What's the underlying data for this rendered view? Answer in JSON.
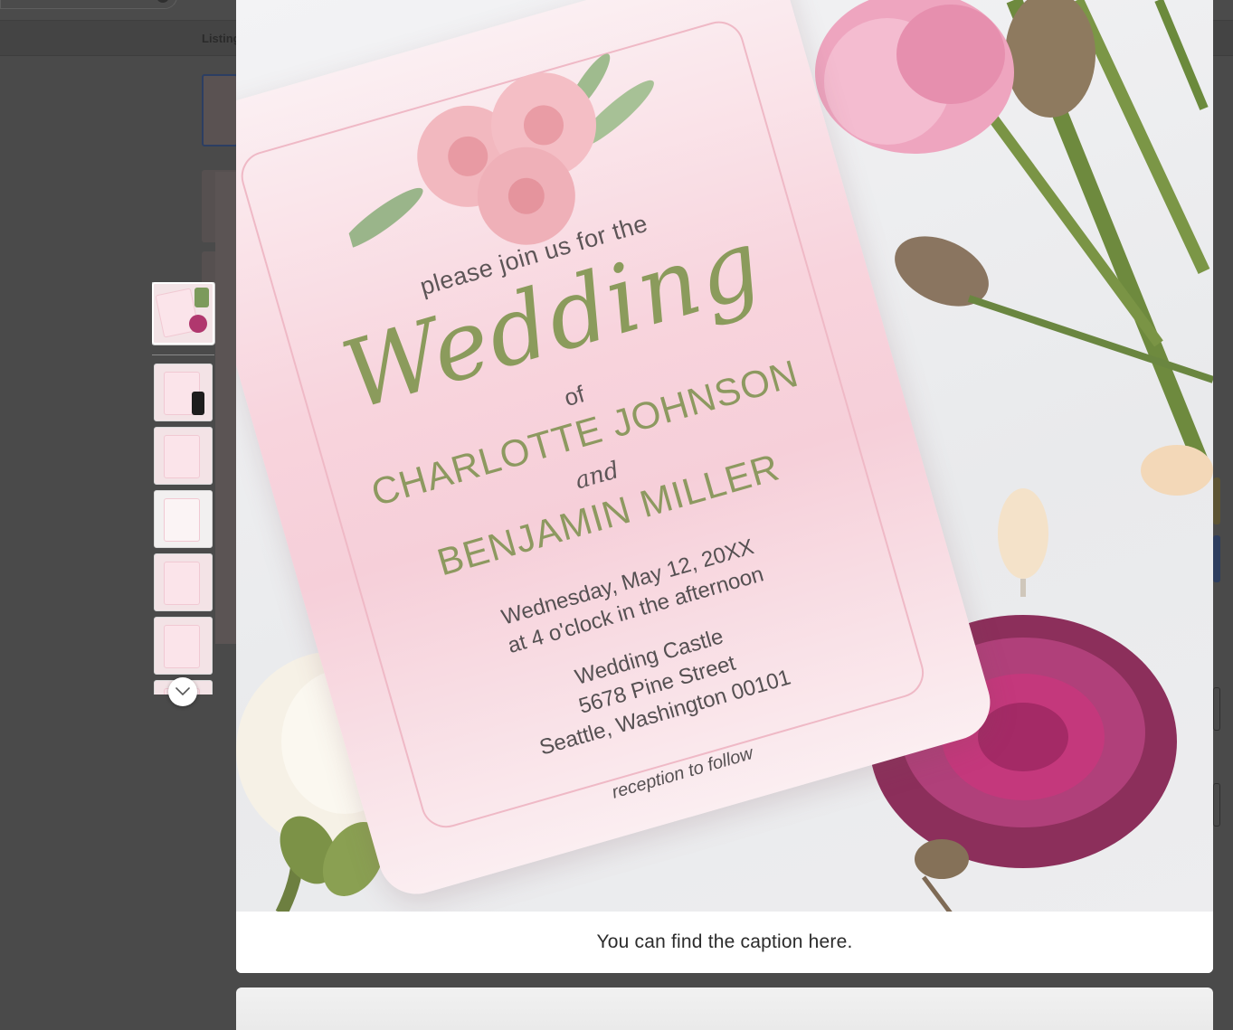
{
  "background": {
    "subnav_label": "Listing"
  },
  "lightbox": {
    "caption": "You can find the caption here.",
    "thumbnails": [
      {
        "name": "thumb-1",
        "active": true
      },
      {
        "name": "thumb-2",
        "active": false
      },
      {
        "name": "thumb-3",
        "active": false
      },
      {
        "name": "thumb-4",
        "active": false
      },
      {
        "name": "thumb-5",
        "active": false
      },
      {
        "name": "thumb-6",
        "active": false
      },
      {
        "name": "thumb-7",
        "active": false
      }
    ],
    "scroll_icon": "chevron-down-icon"
  },
  "invitation": {
    "intro": "please join us for the",
    "script_title": "Wedding",
    "of": "of",
    "name1": "CHARLOTTE JOHNSON",
    "and": "and",
    "name2": "BENJAMIN MILLER",
    "date": "Wednesday, May 12, 20XX",
    "time": "at 4 o'clock in the afternoon",
    "venue": "Wedding Castle",
    "street": "5678 Pine Street",
    "city": "Seattle, Washington 00101",
    "reception": "reception to follow"
  },
  "colors": {
    "overlay": "#4a4a4a",
    "card_pink": "#f8d4dd",
    "olive_text": "#8b9b5c",
    "body_text": "#555052"
  }
}
